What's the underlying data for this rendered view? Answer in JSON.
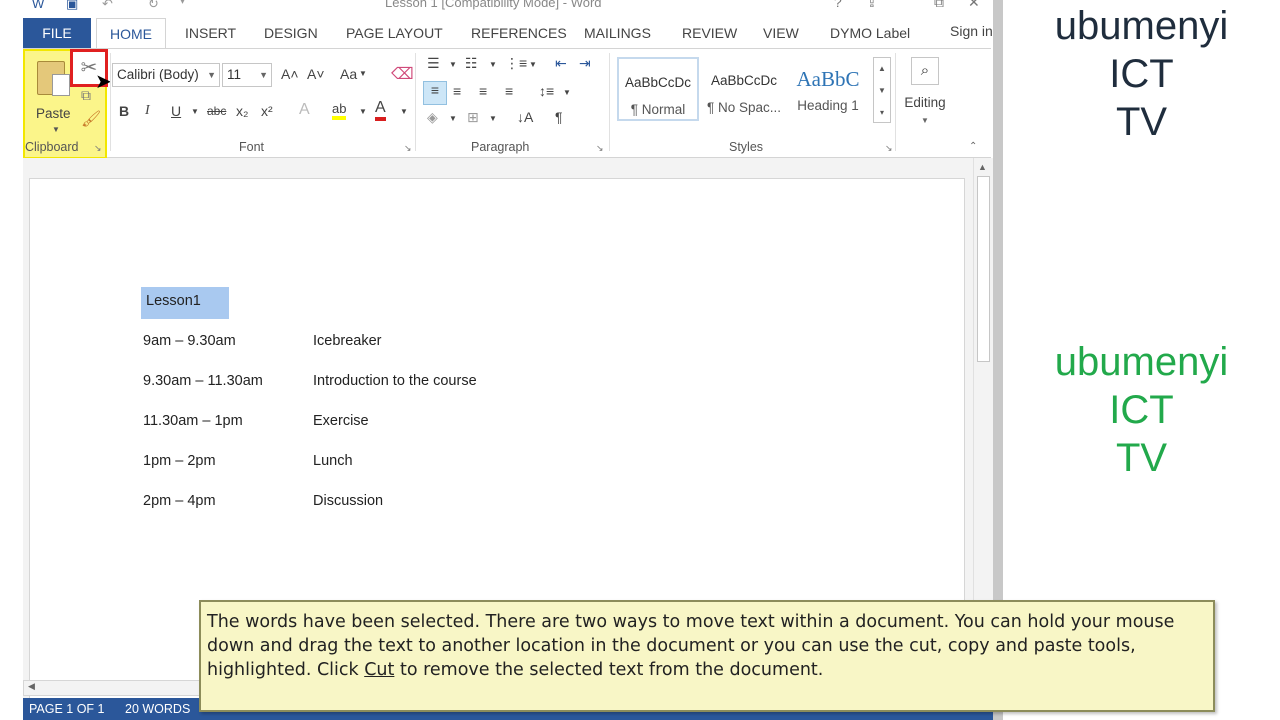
{
  "window": {
    "title": "Lesson 1 [Compatibility Mode] - Word",
    "help_glyph": "?",
    "restore_glyph": "⧉",
    "close_glyph": "✕"
  },
  "tabs": {
    "file": "FILE",
    "home": "HOME",
    "insert": "INSERT",
    "design": "DESIGN",
    "page_layout": "PAGE LAYOUT",
    "references": "REFERENCES",
    "mailings": "MAILINGS",
    "review": "REVIEW",
    "view": "VIEW",
    "dymo": "DYMO Label",
    "sign_in": "Sign in"
  },
  "ribbon": {
    "clipboard": {
      "label": "Clipboard",
      "paste": "Paste"
    },
    "font": {
      "label": "Font",
      "family": "Calibri (Body)",
      "size": "11",
      "bold": "B",
      "italic": "I",
      "underline": "U",
      "strike": "abc",
      "subscript": "x₂",
      "superscript": "x²",
      "grow": "A˄",
      "shrink": "A˅",
      "change_case": "Aa",
      "text_effects": "A",
      "highlight": "ab",
      "font_color": "A"
    },
    "paragraph": {
      "label": "Paragraph"
    },
    "styles": {
      "label": "Styles",
      "items": [
        {
          "sample": "AaBbCcDc",
          "name": "¶ Normal"
        },
        {
          "sample": "AaBbCcDc",
          "name": "¶ No Spac..."
        },
        {
          "sample": "AaBbC",
          "name": "Heading 1"
        }
      ]
    },
    "editing": {
      "label": "Editing"
    }
  },
  "document": {
    "title": "Lesson1",
    "rows": [
      {
        "time": "9am – 9.30am",
        "activity": "Icebreaker"
      },
      {
        "time": "9.30am – 11.30am",
        "activity": "Introduction to the course"
      },
      {
        "time": "11.30am – 1pm",
        "activity": "Exercise"
      },
      {
        "time": "1pm – 2pm",
        "activity": "Lunch"
      },
      {
        "time": "2pm – 4pm",
        "activity": "Discussion"
      }
    ]
  },
  "status": {
    "page": "PAGE 1 OF 1",
    "words": "20 WORDS"
  },
  "watermark": {
    "line1": "ubumenyi",
    "line2": "ICT",
    "line3": "TV"
  },
  "callout": {
    "before": "The words have been selected. There are two ways to move text within a document. You can hold your mouse down and drag the text to another location in the document or you can use the cut, copy and paste tools, highlighted. Click ",
    "link": "Cut",
    "after": " to remove the selected text from the document."
  },
  "colors": {
    "word_blue": "#2b579a",
    "selection": "#a9c9f0",
    "clipboard_highlight": "#fbf58a",
    "cut_highlight": "#e02020",
    "watermark_dark": "#1f2d3d",
    "watermark_green": "#22a94b",
    "callout_bg": "#f8f6c6"
  }
}
